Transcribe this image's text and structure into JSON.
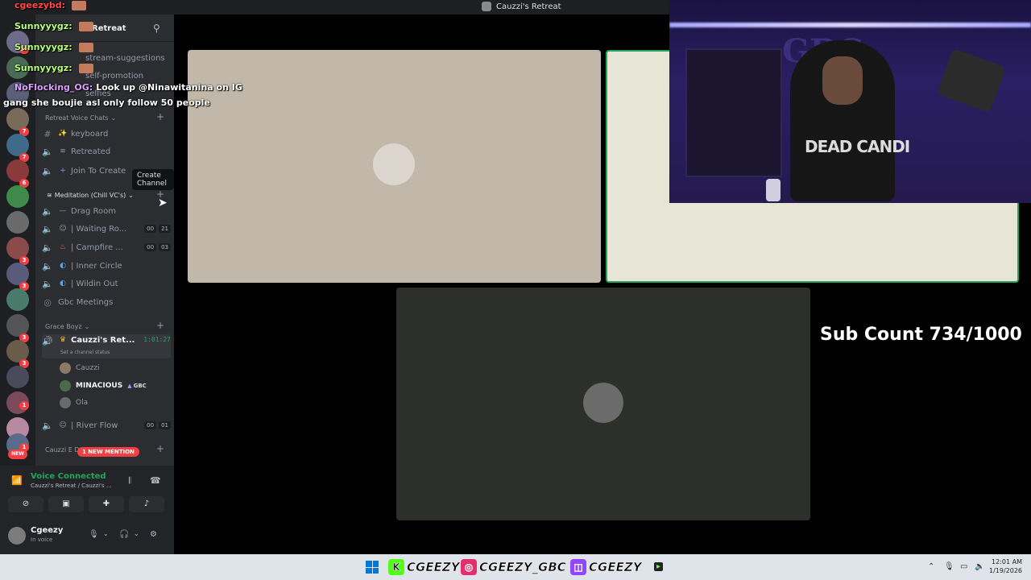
{
  "window": {
    "title": "Cauzzi's Retreat"
  },
  "server": {
    "name": "Retreat"
  },
  "channels": {
    "text_partial": [
      "stream-suggestions",
      "self-promotion",
      "selfies"
    ],
    "categories": [
      {
        "label": "Retreat Voice Chats"
      },
      {
        "label": "Meditation (Chill VC's)"
      },
      {
        "label": "Grace Boyz"
      },
      {
        "label": "Cauzzi E D"
      }
    ],
    "items": [
      {
        "label": "keyboard",
        "icon": "#"
      },
      {
        "label": "Retreated"
      },
      {
        "label": "Join To Create"
      },
      {
        "label": "Drag Room"
      },
      {
        "label": "| Waiting Ro...",
        "count_a": "00",
        "count_b": "21"
      },
      {
        "label": "| Campfire ...",
        "count_a": "00",
        "count_b": "03"
      },
      {
        "label": "| Inner Circle"
      },
      {
        "label": "| Wildin Out"
      },
      {
        "label": "Gbc Meetings"
      },
      {
        "label": "Cauzzi's Ret...",
        "timer": "1:01:27",
        "status": "Set a channel status"
      },
      {
        "label": "| River Flow",
        "count_a": "00",
        "count_b": "01"
      }
    ],
    "voice_users": [
      {
        "name": "Cauzzi"
      },
      {
        "name": "MINACIOUS",
        "tag": "GBC"
      },
      {
        "name": "Ola"
      }
    ],
    "tooltip": "Create Channel",
    "mention_pill": "1 NEW MENTION"
  },
  "rail": {
    "badges": [
      "26",
      "7",
      "7",
      "6",
      "3",
      "3",
      "3",
      "3",
      "1",
      "1"
    ],
    "new_label": "NEW"
  },
  "voice": {
    "title": "Voice Connected",
    "subtitle": "Cauzzi's Retreat / Cauzzi's ...",
    "user": "Cgeezy",
    "user_status": "In voice"
  },
  "chat": [
    {
      "user": "cgeezybd:",
      "text": "",
      "color": "#ff4a4a"
    },
    {
      "user": "Sunnyyygz:",
      "text": ""
    },
    {
      "user": "Sunnyyygz:",
      "text": ""
    },
    {
      "user": "Sunnyyygz:",
      "text": ""
    },
    {
      "user": "NoFlocking_OG:",
      "text": "Look up @Ninawitanina on IG"
    },
    {
      "user": "",
      "text": "gang she boujie asl only follow 50 people"
    }
  ],
  "overlay": {
    "subcount": "Sub Count 734/1000",
    "hoodie_text": "DEAD CANDI",
    "wall_logo": "GBC"
  },
  "taskbar": {
    "socials": [
      {
        "platform": "kick",
        "handle": "CGEEZY",
        "color": "#53fc18"
      },
      {
        "platform": "instagram",
        "handle": "CGEEZY_GBC",
        "color": "#e1306c"
      },
      {
        "platform": "twitch",
        "handle": "CGEEZY",
        "color": "#9146ff"
      }
    ],
    "time": "12:01 AM",
    "date": "1/19/2026"
  },
  "colors": {
    "accent_green": "#23a55a",
    "discord_dark": "#2b2d31",
    "mention_red": "#f23f43"
  }
}
